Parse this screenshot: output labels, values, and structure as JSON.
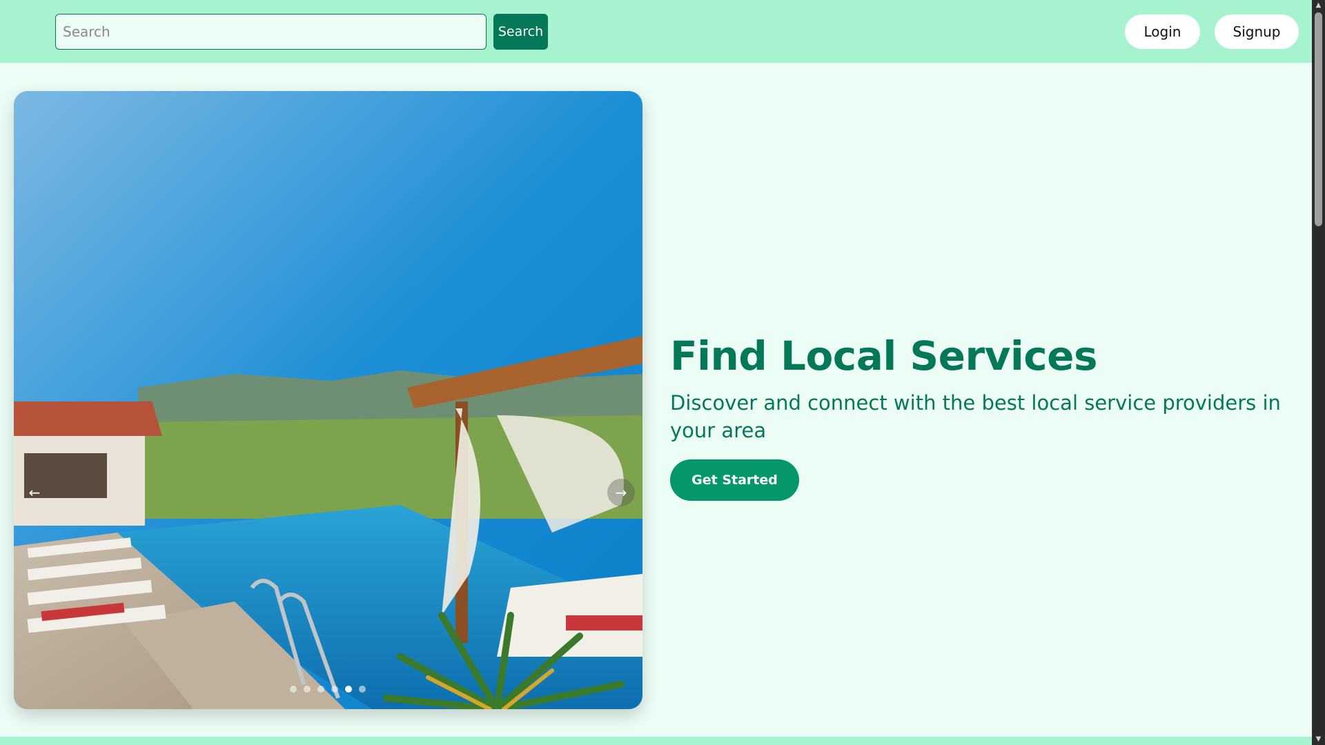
{
  "header": {
    "search_placeholder": "Search",
    "search_button": "Search",
    "login_button": "Login",
    "signup_button": "Signup"
  },
  "carousel": {
    "prev_label": "←",
    "next_label": "→",
    "slide_count": 6,
    "active_slide": 5
  },
  "hero": {
    "title": "Find Local Services",
    "subtitle": "Discover and connect with the best local service providers in your area",
    "cta": "Get Started"
  },
  "colors": {
    "nav_bg": "#a7f3d0",
    "page_bg": "#ecfdf5",
    "accent": "#047857",
    "cta": "#059669"
  }
}
